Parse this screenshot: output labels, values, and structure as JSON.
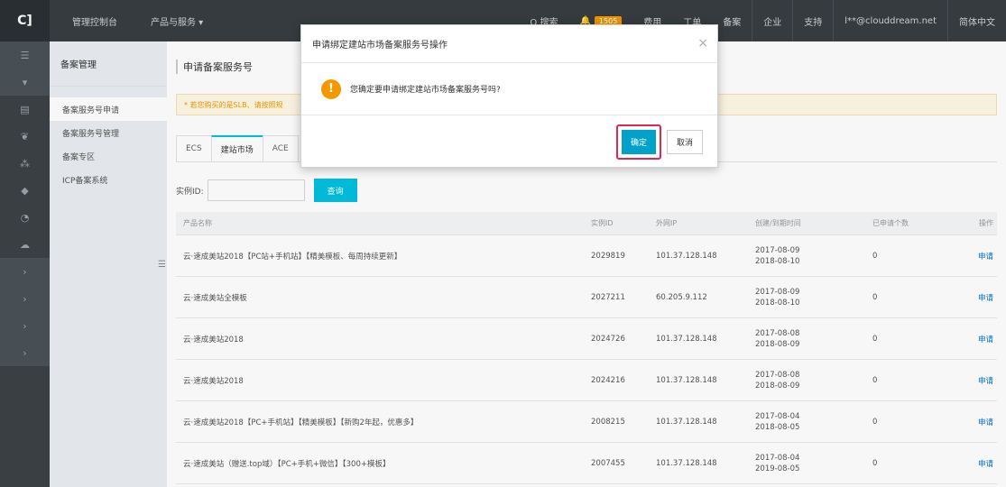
{
  "topbar": {
    "logo": "C]",
    "console": "管理控制台",
    "products": "产品与服务 ▾",
    "search": "Q 搜索",
    "bell_icon": "🔔",
    "badge": "1505",
    "fees": "费用",
    "tickets": "工单",
    "beian": "备案",
    "enterprise": "企业",
    "support": "支持",
    "account": "l**@clouddream.net",
    "language": "简体中文"
  },
  "rail": {
    "icons": [
      "☰",
      "▾",
      "▤",
      "❦",
      "⁂",
      "◆",
      "◔",
      "☁",
      "›",
      "›",
      "›",
      "›"
    ]
  },
  "sidebar": {
    "title": "备案管理",
    "items": [
      {
        "label": "备案服务号申请"
      },
      {
        "label": "备案服务号管理"
      },
      {
        "label": "备案专区"
      },
      {
        "label": "ICP备案系统"
      }
    ],
    "collapse_icon": "☰"
  },
  "main": {
    "page_title": "申请备案服务号",
    "alert": "* 若您购买的是SLB、请按照规",
    "tabs": [
      {
        "label": "ECS"
      },
      {
        "label": "建站市场"
      },
      {
        "label": "ACE"
      }
    ],
    "filter": {
      "label": "实例ID:",
      "value": "",
      "button": "查询"
    },
    "table": {
      "headers": {
        "name": "产品名称",
        "id": "实例ID",
        "ip": "外网IP",
        "time": "创建/到期时间",
        "count": "已申请个数",
        "op": "操作"
      },
      "rows": [
        {
          "name": "云·速成美站2018【PC站+手机站】【精美模板、每周持续更新】",
          "id": "2029819",
          "ip": "101.37.128.148",
          "created": "2017-08-09",
          "expires": "2018-08-10",
          "count": "0",
          "op": "申请"
        },
        {
          "name": "云·速成美站全模板",
          "id": "2027211",
          "ip": "60.205.9.112",
          "created": "2017-08-09",
          "expires": "2018-08-10",
          "count": "0",
          "op": "申请"
        },
        {
          "name": "云·速成美站2018",
          "id": "2024726",
          "ip": "101.37.128.148",
          "created": "2017-08-08",
          "expires": "2018-08-09",
          "count": "0",
          "op": "申请"
        },
        {
          "name": "云·速成美站2018",
          "id": "2024216",
          "ip": "101.37.128.148",
          "created": "2017-08-08",
          "expires": "2018-08-09",
          "count": "0",
          "op": "申请"
        },
        {
          "name": "云·速成美站2018【PC+手机站】【精美模板】【新购2年起，优惠多】",
          "id": "2008215",
          "ip": "101.37.128.148",
          "created": "2017-08-04",
          "expires": "2018-08-05",
          "count": "0",
          "op": "申请"
        },
        {
          "name": "云·速成美站（赠送.top域）【PC+手机+微信】【300+模板】",
          "id": "2007455",
          "ip": "101.37.128.148",
          "created": "2017-08-04",
          "expires": "2019-08-05",
          "count": "0",
          "op": "申请"
        }
      ]
    }
  },
  "modal": {
    "title": "申请绑定建站市场备案服务号操作",
    "close": "×",
    "icon": "!",
    "message": "您确定要申请绑定建站市场备案服务号吗?",
    "confirm": "确定",
    "cancel": "取消"
  }
}
